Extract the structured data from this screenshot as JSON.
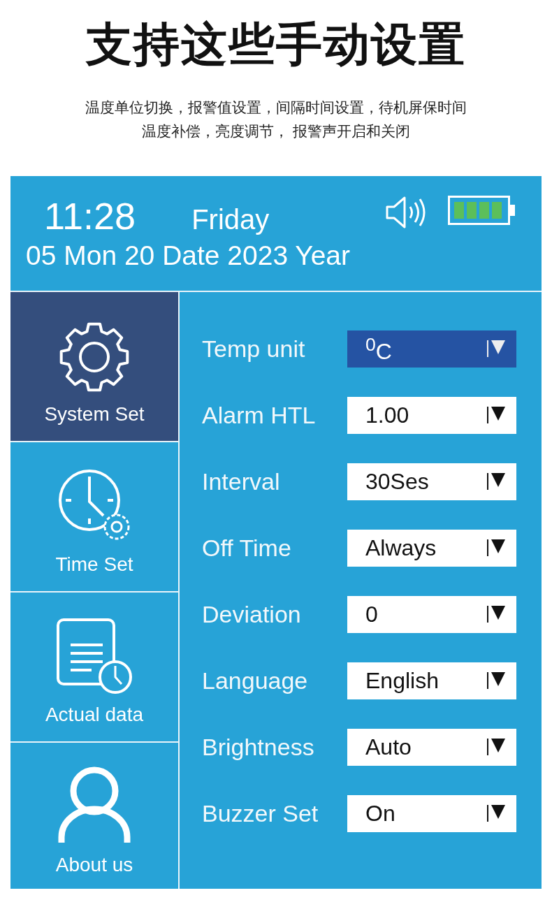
{
  "headline": "支持这些手动设置",
  "subtitle": [
    "温度单位切换，报警值设置，间隔时间设置，待机屏保时间",
    "温度补偿，亮度调节， 报警声开启和关闭"
  ],
  "status": {
    "time": "11:28",
    "weekday": "Friday",
    "date": "05 Mon 20 Date 2023 Year",
    "sound_on": true
  },
  "sidebar": {
    "items": [
      {
        "kind": "gear",
        "label": "System Set",
        "selected": true
      },
      {
        "kind": "clock",
        "label": "Time Set",
        "selected": false
      },
      {
        "kind": "document",
        "label": "Actual data",
        "selected": false
      },
      {
        "kind": "person",
        "label": "About us",
        "selected": false
      }
    ]
  },
  "settings": [
    {
      "label": "Temp unit",
      "value": "$^{0}$C",
      "selected": true
    },
    {
      "label": "Alarm HTL",
      "value": "1.00",
      "selected": false
    },
    {
      "label": "Interval",
      "value": "30Ses",
      "selected": false
    },
    {
      "label": "Off Time",
      "value": "Always",
      "selected": false
    },
    {
      "label": "Deviation",
      "value": "0",
      "selected": false
    },
    {
      "label": "Language",
      "value": "English",
      "selected": false
    },
    {
      "label": "Brightness",
      "value": "Auto",
      "selected": false
    },
    {
      "label": "Buzzer Set",
      "value": "On",
      "selected": false
    }
  ]
}
